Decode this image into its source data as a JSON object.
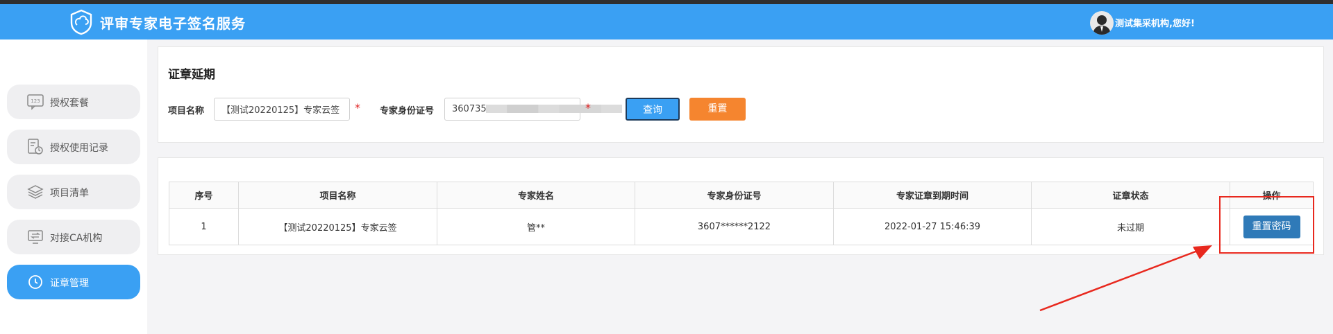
{
  "header": {
    "app_title": "评审专家电子签名服务",
    "greeting": "测试集采机构,您好!"
  },
  "sidebar": {
    "items": [
      {
        "label": "授权套餐",
        "icon": "package-123-icon"
      },
      {
        "label": "授权使用记录",
        "icon": "usage-record-icon"
      },
      {
        "label": "项目清单",
        "icon": "layers-icon"
      },
      {
        "label": "对接CA机构",
        "icon": "ca-connect-icon"
      },
      {
        "label": "证章管理",
        "icon": "clock-icon",
        "active": true
      }
    ]
  },
  "search": {
    "title": "证章延期",
    "project_label": "项目名称",
    "project_value": "【测试20220125】专家云签",
    "id_label": "专家身份证号",
    "id_value": "360735",
    "required_mark": "*",
    "query_button": "查询",
    "reset_button": "重置"
  },
  "table": {
    "headers": [
      "序号",
      "项目名称",
      "专家姓名",
      "专家身份证号",
      "专家证章到期时间",
      "证章状态",
      "操作"
    ],
    "rows": [
      {
        "index": "1",
        "project": "【测试20220125】专家云签",
        "name": "管**",
        "id_number": "3607******2122",
        "expiry": "2022-01-27 15:46:39",
        "status": "未过期",
        "action": "重置密码"
      }
    ]
  },
  "colors": {
    "header_bg": "#3aa0f3",
    "active_nav": "#3aa0f3",
    "reset_button": "#f5852f",
    "action_button": "#2f7ab8",
    "annotation": "#e8281e"
  }
}
